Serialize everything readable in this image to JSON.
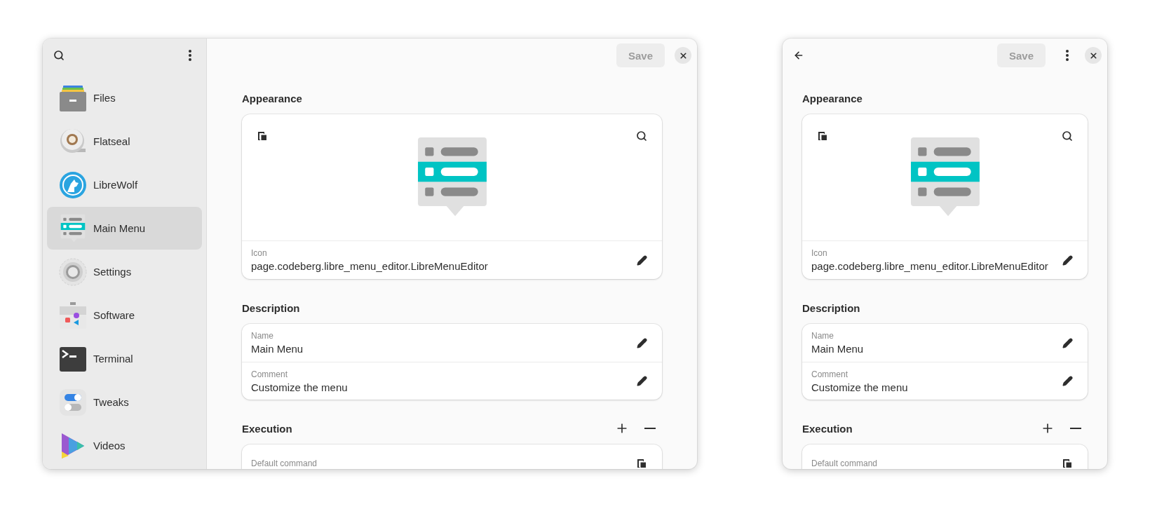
{
  "windows": [
    {
      "sidebar": {
        "buttons": [
          {
            "kind": "search"
          },
          {
            "kind": "menu"
          }
        ],
        "items": [
          {
            "label": "Files",
            "selected": false
          },
          {
            "label": "Flatseal",
            "selected": false
          },
          {
            "label": "LibreWolf",
            "selected": false
          },
          {
            "label": "Main Menu",
            "selected": true
          },
          {
            "label": "Settings",
            "selected": false
          },
          {
            "label": "Software",
            "selected": false
          },
          {
            "label": "Terminal",
            "selected": false
          },
          {
            "label": "Tweaks",
            "selected": false
          },
          {
            "label": "Videos",
            "selected": false
          }
        ]
      },
      "header": {
        "end": [
          {
            "kind": "save",
            "label": "Save",
            "disabled": true
          },
          {
            "kind": "close"
          }
        ]
      },
      "sections": [
        {
          "kind": "preview",
          "title": "Appearance",
          "rows": [
            {
              "kind": "edit",
              "label": "Icon",
              "value": "page.codeberg.libre_menu_editor.LibreMenuEditor"
            }
          ]
        },
        {
          "kind": "fields",
          "title": "Description",
          "rows": [
            {
              "kind": "edit",
              "label": "Name",
              "value": "Main Menu"
            },
            {
              "kind": "edit",
              "label": "Comment",
              "value": "Customize the menu"
            }
          ]
        },
        {
          "kind": "list",
          "title": "Execution",
          "rows": [
            {
              "kind": "copy",
              "label": "Default command"
            }
          ]
        }
      ]
    },
    {
      "header": {
        "start": [
          {
            "kind": "back"
          }
        ],
        "end": [
          {
            "kind": "save",
            "label": "Save",
            "disabled": true
          },
          {
            "kind": "menu"
          },
          {
            "kind": "close"
          }
        ]
      },
      "sections": [
        {
          "kind": "preview",
          "title": "Appearance",
          "rows": [
            {
              "kind": "edit",
              "label": "Icon",
              "value": "page.codeberg.libre_menu_editor.LibreMenuEditor"
            }
          ]
        },
        {
          "kind": "fields",
          "title": "Description",
          "rows": [
            {
              "kind": "edit",
              "label": "Name",
              "value": "Main Menu"
            },
            {
              "kind": "edit",
              "label": "Comment",
              "value": "Customize the menu"
            }
          ]
        },
        {
          "kind": "list",
          "title": "Execution",
          "rows": [
            {
              "kind": "copy",
              "label": "Default command"
            }
          ]
        }
      ]
    }
  ]
}
